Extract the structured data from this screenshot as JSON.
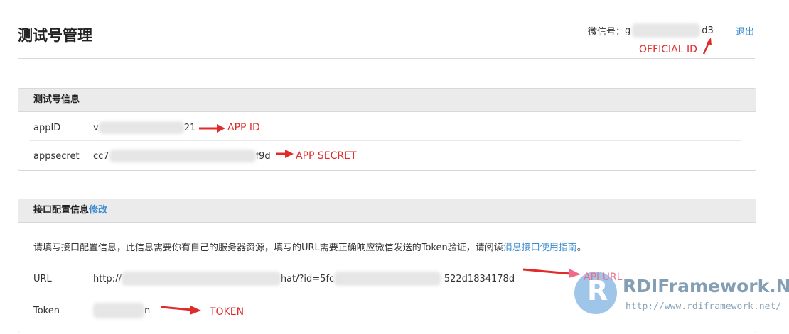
{
  "header": {
    "title": "测试号管理",
    "wechat_label": "微信号：",
    "wechat_prefix": "g",
    "wechat_suffix": "d3",
    "logout": "退出"
  },
  "test_account_panel": {
    "title": "测试号信息",
    "rows": [
      {
        "key": "appID",
        "prefix": "v",
        "suffix": "21"
      },
      {
        "key": "appsecret",
        "prefix": "cc7",
        "suffix": "f9d"
      }
    ]
  },
  "interface_panel": {
    "title": "接口配置信息",
    "edit_link": "修改",
    "description": "请填写接口配置信息，此信息需要你有自己的服务器资源，填写的URL需要正确响应微信发送的Token验证，请阅读",
    "guide_link": "消息接口使用指南",
    "description_end": "。",
    "url": {
      "key": "URL",
      "prefix": "http://",
      "middle": "hat/?id=5fc",
      "suffix": "-522d1834178d"
    },
    "token": {
      "key": "Token",
      "prefix": "",
      "suffix": "n"
    }
  },
  "annotations": {
    "official_id": "OFFICIAL  ID",
    "app_id": "APP  ID",
    "app_secret": "APP  SECRET",
    "api_url": "API URL",
    "token": "TOKEN",
    "color": "#e02b2b"
  },
  "watermark": {
    "logo_letter": "R",
    "title": "RDIFramework.NET",
    "url": "http://www.rdiframework.net/"
  }
}
